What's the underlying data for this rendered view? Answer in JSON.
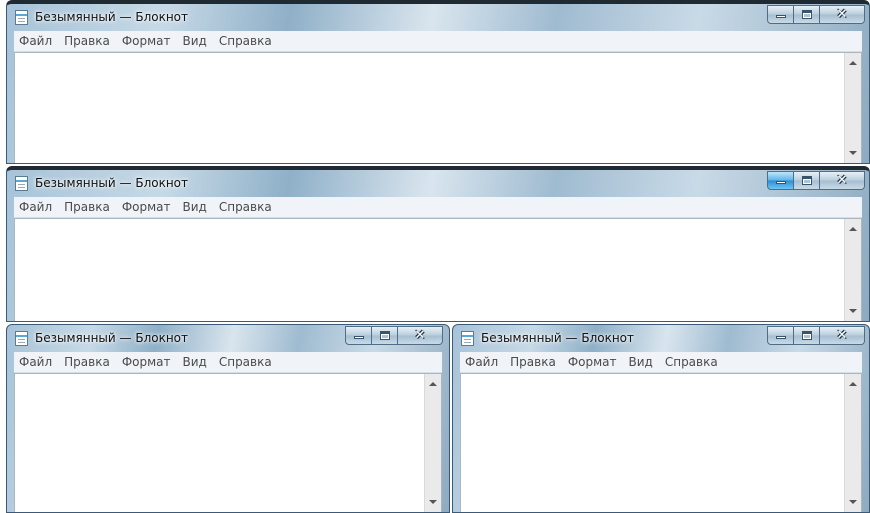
{
  "window_title": "Безымянный — Блокнот",
  "menu": [
    "Файл",
    "Правка",
    "Формат",
    "Вид",
    "Справка"
  ],
  "controls": {
    "minimize": "",
    "maximize": "",
    "close": "✕"
  },
  "windows": [
    {
      "id": "window-1",
      "active": false
    },
    {
      "id": "window-2",
      "active": true
    },
    {
      "id": "window-3",
      "active": false
    },
    {
      "id": "window-4",
      "active": false
    }
  ]
}
